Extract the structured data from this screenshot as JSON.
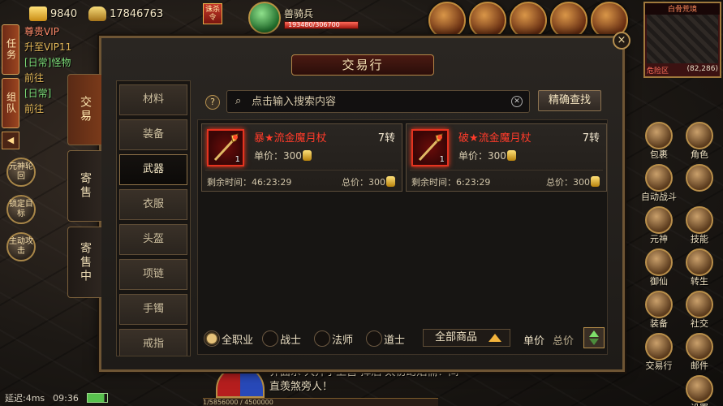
{
  "hud": {
    "ingots": "9840",
    "gold": "17846763",
    "flag_text": "诛杀令",
    "target_name": "兽骑兵",
    "target_hp": "193480/306700",
    "minimap_title": "白骨荒境",
    "minimap_zone": "危险区",
    "minimap_coords": "(82,286)"
  },
  "left_tabs": [
    "任务",
    "组队"
  ],
  "quests": [
    {
      "text": "尊贵VIP",
      "style": "q-red"
    },
    {
      "text": "升至VIP11",
      "style": "q-gold"
    },
    {
      "text": "[日常]怪物",
      "style": "q-green"
    },
    {
      "text": "前往",
      "style": "q-gold"
    },
    {
      "text": "[日常]",
      "style": "q-green"
    },
    {
      "text": "前往",
      "style": "q-gold"
    }
  ],
  "left_circles": [
    "元神轮回",
    "锁定目标",
    "主动攻击"
  ],
  "status": {
    "latency": "延迟:4ms",
    "clock": "09:36"
  },
  "chat": {
    "line1": "界面杀 大开小卫营 挥酒 太初幻焰俑！间",
    "line2": "直羡煞旁人！",
    "exp": "1/5856000 / 4500000"
  },
  "right_buttons": [
    "包裹",
    "角色",
    "自动战斗",
    "",
    "元神",
    "技能",
    "御仙",
    "转生",
    "装备",
    "社交",
    "交易行",
    "邮件",
    "",
    "设置"
  ],
  "panel": {
    "title": "交易行",
    "close": "×",
    "side_tabs": [
      "交易",
      "寄售",
      "寄售中"
    ],
    "categories": [
      "材料",
      "装备",
      "武器",
      "衣服",
      "头盔",
      "项链",
      "手镯",
      "戒指"
    ],
    "active_category": "武器",
    "search_placeholder": "点击输入搜索内容",
    "exact_search": "精确查找",
    "help": "?",
    "items": [
      {
        "name": "暴★流金魔月杖",
        "level": "7转",
        "qty": "1",
        "unit_price": "单价：300",
        "time_left": "剩余时间：46:23:29",
        "total": "总价：300"
      },
      {
        "name": "破★流金魔月杖",
        "level": "7转",
        "qty": "1",
        "unit_price": "单价：300",
        "time_left": "剩余时间：6:23:29",
        "total": "总价：300"
      }
    ],
    "filters": {
      "classes": [
        {
          "label": "全职业",
          "checked": true
        },
        {
          "label": "战士",
          "checked": false
        },
        {
          "label": "法师",
          "checked": false
        },
        {
          "label": "道士",
          "checked": false
        }
      ],
      "product_type": "全部商品",
      "sort_unit": "单价",
      "sort_total": "总价"
    }
  },
  "colors": {
    "item_name": "#ff3b2a",
    "panel_border": "#6e5534",
    "title_bg": "#4a1a12"
  }
}
